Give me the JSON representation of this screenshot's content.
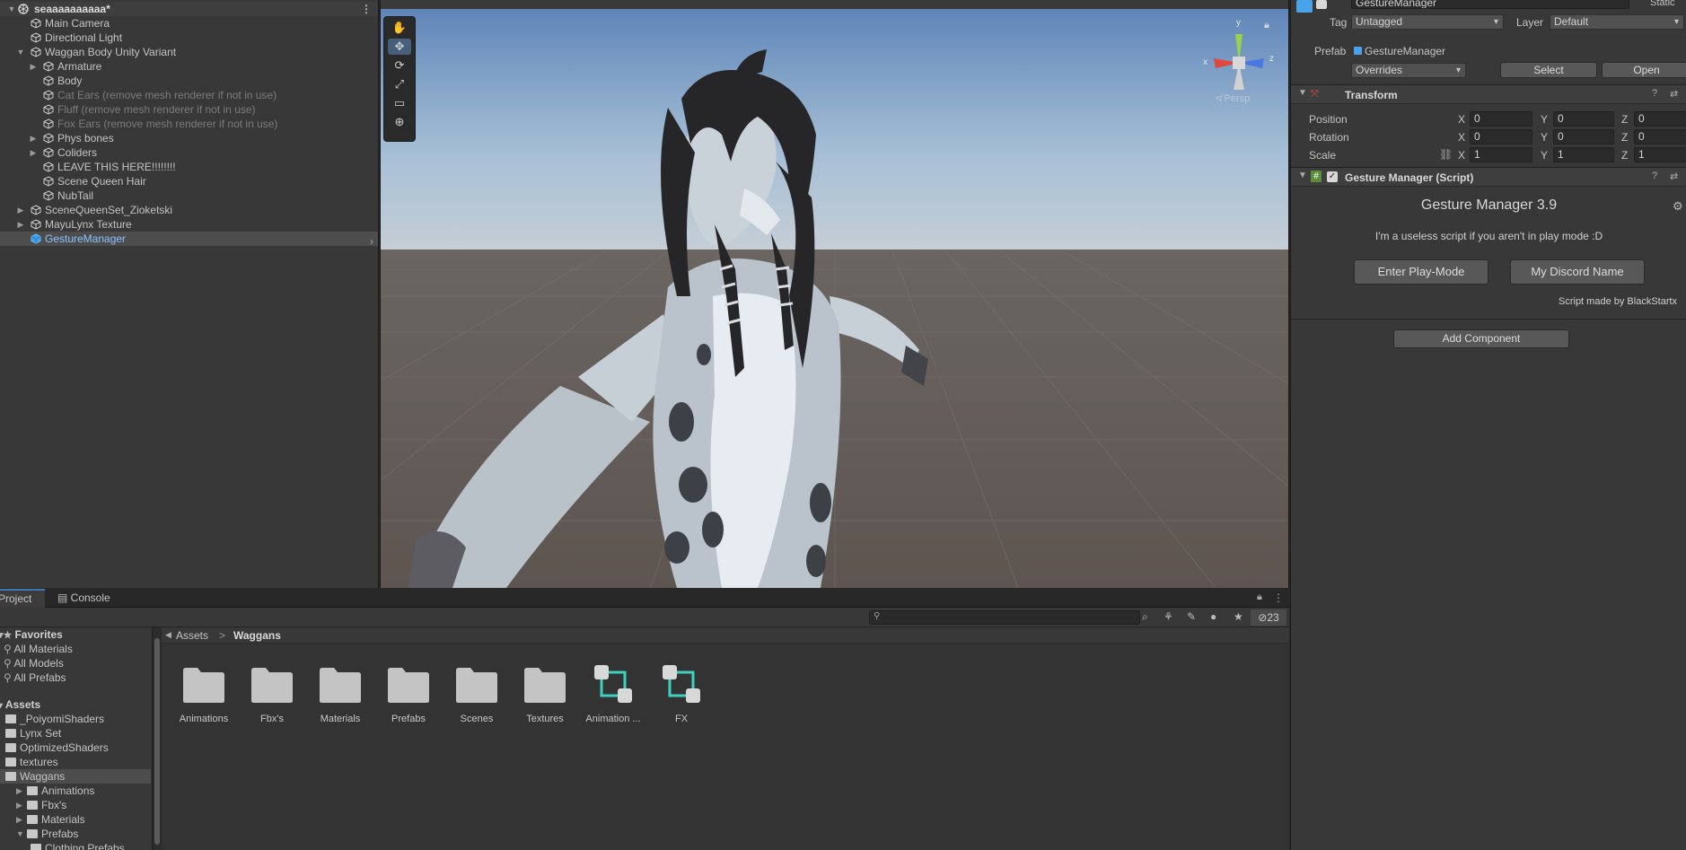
{
  "hierarchy": {
    "scene_name": "seaaaaaaaaaa*",
    "items": [
      {
        "label": "Main Camera"
      },
      {
        "label": "Directional Light"
      },
      {
        "label": "Waggan Body Unity Variant"
      },
      {
        "label": "Armature"
      },
      {
        "label": "Body"
      },
      {
        "label": "Cat Ears (remove mesh renderer if not in use)"
      },
      {
        "label": "Fluff (remove mesh renderer if not in use)"
      },
      {
        "label": "Fox Ears (remove mesh renderer if not in use)"
      },
      {
        "label": "Phys bones"
      },
      {
        "label": "Coliders"
      },
      {
        "label": "LEAVE THIS HERE!!!!!!!!"
      },
      {
        "label": "Scene Queen Hair"
      },
      {
        "label": "NubTail"
      },
      {
        "label": "SceneQueenSet_Zioketski"
      },
      {
        "label": "MayuLynx Texture"
      },
      {
        "label": "GestureManager"
      }
    ]
  },
  "scene_view": {
    "persp_label": "≮ Persp",
    "axis_labels": {
      "y": "y",
      "x": "x",
      "z": "z"
    }
  },
  "inspector": {
    "object_name": "GestureManager",
    "static_label": "Static",
    "tag_label": "Tag",
    "tag_value": "Untagged",
    "layer_label": "Layer",
    "layer_value": "Default",
    "prefab_label": "Prefab",
    "prefab_value": "GestureManager",
    "overrides_value": "Overrides",
    "select_button": "Select",
    "open_button": "Open",
    "transform": {
      "title": "Transform",
      "position_label": "Position",
      "rotation_label": "Rotation",
      "scale_label": "Scale",
      "axis_x": "X",
      "axis_y": "Y",
      "axis_z": "Z",
      "position": {
        "x": "0",
        "y": "0",
        "z": "0"
      },
      "rotation": {
        "x": "0",
        "y": "0",
        "z": "0"
      },
      "scale": {
        "x": "1",
        "y": "1",
        "z": "1"
      }
    },
    "script": {
      "title": "Gesture Manager (Script)",
      "heading": "Gesture Manager 3.9",
      "message": "I'm a useless script if you aren't in play mode :D",
      "enter_play_button": "Enter Play-Mode",
      "discord_button": "My Discord Name",
      "credit": "Script made by BlackStartx"
    },
    "add_component_button": "Add Component"
  },
  "project": {
    "tabs": [
      {
        "label": "Project"
      },
      {
        "label": "Console"
      }
    ],
    "hidden_count": "23",
    "favorites_label": "Favorites",
    "favorites": [
      {
        "label": "All Materials"
      },
      {
        "label": "All Models"
      },
      {
        "label": "All Prefabs"
      }
    ],
    "assets_label": "Assets",
    "assets_tree": [
      {
        "label": "_PoiyomiShaders"
      },
      {
        "label": "Lynx Set"
      },
      {
        "label": "OptimizedShaders"
      },
      {
        "label": "textures"
      },
      {
        "label": "Waggans"
      },
      {
        "label": "Animations"
      },
      {
        "label": "Fbx's"
      },
      {
        "label": "Materials"
      },
      {
        "label": "Prefabs"
      },
      {
        "label": "Clothing Prefabs"
      }
    ],
    "breadcrumb": {
      "root": "Assets",
      "sep": ">",
      "current": "Waggans"
    },
    "assets": [
      {
        "label": "Animations",
        "kind": "folder"
      },
      {
        "label": "Fbx's",
        "kind": "folder"
      },
      {
        "label": "Materials",
        "kind": "folder"
      },
      {
        "label": "Prefabs",
        "kind": "folder"
      },
      {
        "label": "Scenes",
        "kind": "folder"
      },
      {
        "label": "Textures",
        "kind": "folder"
      },
      {
        "label": "Animation ...",
        "kind": "animator"
      },
      {
        "label": "FX",
        "kind": "animator"
      }
    ]
  }
}
